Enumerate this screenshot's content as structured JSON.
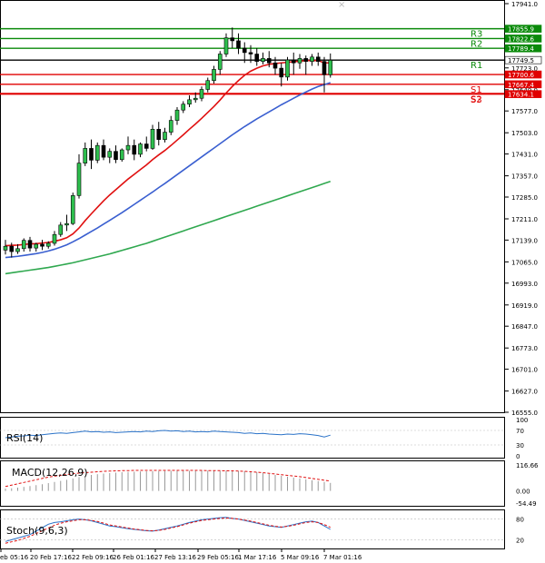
{
  "chart_data": {
    "type": "candlestick",
    "main_panel": {
      "ylim": [
        16555.0,
        17941.0
      ],
      "y_ticks": [
        "17941.0",
        "17859.0",
        "17723.0",
        "17649.0",
        "17577.0",
        "17503.0",
        "17431.0",
        "17357.0",
        "17285.0",
        "17211.0",
        "17139.0",
        "17065.0",
        "16993.0",
        "16919.0",
        "16847.0",
        "16773.0",
        "16701.0",
        "16627.0",
        "16555.0"
      ],
      "candles": [
        {
          "o": 17105,
          "h": 17140,
          "c": 17118,
          "l": 17090
        },
        {
          "o": 17118,
          "h": 17130,
          "c": 17100,
          "l": 17080
        },
        {
          "o": 17100,
          "h": 17125,
          "c": 17110,
          "l": 17092
        },
        {
          "o": 17110,
          "h": 17145,
          "c": 17138,
          "l": 17100
        },
        {
          "o": 17138,
          "h": 17150,
          "c": 17112,
          "l": 17100
        },
        {
          "o": 17112,
          "h": 17130,
          "c": 17125,
          "l": 17100
        },
        {
          "o": 17125,
          "h": 17140,
          "c": 17118,
          "l": 17105
        },
        {
          "o": 17118,
          "h": 17135,
          "c": 17128,
          "l": 17110
        },
        {
          "o": 17128,
          "h": 17170,
          "c": 17158,
          "l": 17120
        },
        {
          "o": 17158,
          "h": 17200,
          "c": 17190,
          "l": 17150
        },
        {
          "o": 17190,
          "h": 17225,
          "c": 17195,
          "l": 17170
        },
        {
          "o": 17195,
          "h": 17300,
          "c": 17290,
          "l": 17190
        },
        {
          "o": 17290,
          "h": 17430,
          "c": 17400,
          "l": 17280
        },
        {
          "o": 17400,
          "h": 17470,
          "c": 17450,
          "l": 17390
        },
        {
          "o": 17450,
          "h": 17480,
          "c": 17410,
          "l": 17380
        },
        {
          "o": 17410,
          "h": 17470,
          "c": 17460,
          "l": 17400
        },
        {
          "o": 17460,
          "h": 17480,
          "c": 17420,
          "l": 17410
        },
        {
          "o": 17420,
          "h": 17450,
          "c": 17440,
          "l": 17400
        },
        {
          "o": 17440,
          "h": 17460,
          "c": 17412,
          "l": 17400
        },
        {
          "o": 17412,
          "h": 17450,
          "c": 17445,
          "l": 17405
        },
        {
          "o": 17445,
          "h": 17490,
          "c": 17460,
          "l": 17430
        },
        {
          "o": 17460,
          "h": 17480,
          "c": 17430,
          "l": 17410
        },
        {
          "o": 17430,
          "h": 17470,
          "c": 17465,
          "l": 17420
        },
        {
          "o": 17465,
          "h": 17490,
          "c": 17450,
          "l": 17440
        },
        {
          "o": 17450,
          "h": 17530,
          "c": 17515,
          "l": 17445
        },
        {
          "o": 17515,
          "h": 17540,
          "c": 17480,
          "l": 17460
        },
        {
          "o": 17480,
          "h": 17520,
          "c": 17505,
          "l": 17470
        },
        {
          "o": 17505,
          "h": 17560,
          "c": 17545,
          "l": 17495
        },
        {
          "o": 17545,
          "h": 17590,
          "c": 17580,
          "l": 17530
        },
        {
          "o": 17580,
          "h": 17610,
          "c": 17600,
          "l": 17570
        },
        {
          "o": 17600,
          "h": 17630,
          "c": 17615,
          "l": 17590
        },
        {
          "o": 17615,
          "h": 17640,
          "c": 17620,
          "l": 17605
        },
        {
          "o": 17620,
          "h": 17660,
          "c": 17650,
          "l": 17610
        },
        {
          "o": 17650,
          "h": 17690,
          "c": 17680,
          "l": 17640
        },
        {
          "o": 17680,
          "h": 17730,
          "c": 17718,
          "l": 17670
        },
        {
          "o": 17718,
          "h": 17780,
          "c": 17770,
          "l": 17700
        },
        {
          "o": 17770,
          "h": 17840,
          "c": 17825,
          "l": 17760
        },
        {
          "o": 17825,
          "h": 17860,
          "c": 17815,
          "l": 17790
        },
        {
          "o": 17815,
          "h": 17840,
          "c": 17790,
          "l": 17770
        },
        {
          "o": 17790,
          "h": 17810,
          "c": 17775,
          "l": 17740
        },
        {
          "o": 17775,
          "h": 17800,
          "c": 17770,
          "l": 17740
        },
        {
          "o": 17770,
          "h": 17790,
          "c": 17745,
          "l": 17730
        },
        {
          "o": 17745,
          "h": 17775,
          "c": 17755,
          "l": 17735
        },
        {
          "o": 17755,
          "h": 17780,
          "c": 17740,
          "l": 17725
        },
        {
          "o": 17740,
          "h": 17760,
          "c": 17722,
          "l": 17700
        },
        {
          "o": 17722,
          "h": 17740,
          "c": 17692,
          "l": 17660
        },
        {
          "o": 17692,
          "h": 17760,
          "c": 17750,
          "l": 17680
        },
        {
          "o": 17750,
          "h": 17775,
          "c": 17740,
          "l": 17700
        },
        {
          "o": 17740,
          "h": 17770,
          "c": 17755,
          "l": 17720
        },
        {
          "o": 17755,
          "h": 17765,
          "c": 17745,
          "l": 17700
        },
        {
          "o": 17745,
          "h": 17770,
          "c": 17760,
          "l": 17730
        },
        {
          "o": 17760,
          "h": 17775,
          "c": 17745,
          "l": 17730
        },
        {
          "o": 17745,
          "h": 17760,
          "c": 17700,
          "l": 17640
        },
        {
          "o": 17700,
          "h": 17772,
          "c": 17749,
          "l": 17690
        }
      ],
      "ma_fast": [
        17120,
        17121,
        17122,
        17124,
        17126,
        17127,
        17129,
        17131,
        17135,
        17140,
        17147,
        17160,
        17180,
        17205,
        17228,
        17250,
        17272,
        17292,
        17310,
        17328,
        17346,
        17362,
        17378,
        17394,
        17412,
        17428,
        17443,
        17460,
        17478,
        17496,
        17515,
        17533,
        17552,
        17572,
        17592,
        17614,
        17638,
        17660,
        17680,
        17698,
        17712,
        17722,
        17730,
        17735,
        17738,
        17740,
        17742,
        17744,
        17746,
        17748,
        17748,
        17748,
        17740,
        17740
      ],
      "ma_mid": [
        17080,
        17082,
        17084,
        17087,
        17090,
        17093,
        17097,
        17102,
        17108,
        17115,
        17123,
        17133,
        17144,
        17156,
        17168,
        17180,
        17193,
        17206,
        17219,
        17232,
        17246,
        17260,
        17274,
        17288,
        17302,
        17317,
        17331,
        17346,
        17361,
        17376,
        17391,
        17406,
        17421,
        17436,
        17451,
        17466,
        17481,
        17496,
        17510,
        17524,
        17537,
        17550,
        17562,
        17574,
        17586,
        17598,
        17609,
        17620,
        17631,
        17641,
        17651,
        17660,
        17666,
        17673
      ],
      "ma_slow": [
        17025,
        17028,
        17031,
        17034,
        17037,
        17040,
        17043,
        17046,
        17050,
        17054,
        17058,
        17062,
        17067,
        17072,
        17077,
        17082,
        17087,
        17092,
        17098,
        17104,
        17110,
        17116,
        17122,
        17128,
        17135,
        17142,
        17149,
        17156,
        17163,
        17170,
        17177,
        17184,
        17191,
        17198,
        17205,
        17212,
        17219,
        17226,
        17233,
        17240,
        17247,
        17254,
        17261,
        17268,
        17275,
        17282,
        17289,
        17296,
        17303,
        17310,
        17317,
        17324,
        17331,
        17338
      ],
      "levels": [
        {
          "label": "R3",
          "value": 17855.9,
          "tag": "17855.9",
          "color": "#0a8a0a"
        },
        {
          "label": "R2",
          "value": 17822.6,
          "tag": "17822.6",
          "color": "#0a8a0a"
        },
        {
          "label": "",
          "value": 17789.4,
          "tag": "17789.4",
          "color": "#0a8a0a"
        },
        {
          "label": "R1",
          "value": 17749.5,
          "tag": "17749.5",
          "color": "#000000"
        },
        {
          "label": "",
          "value": 17700.6,
          "tag": "17700.6",
          "color": "#e00000"
        },
        {
          "label": "S1",
          "value": 17667.4,
          "tag": "17667.4",
          "color": "#e00000"
        },
        {
          "label": "S2",
          "value": 17634.1,
          "tag": "17634.1",
          "color": "#e00000"
        },
        {
          "label": "S3",
          "value": 17634.1,
          "tag": "",
          "color": "#e00000"
        }
      ],
      "price_tag": "17749.5"
    },
    "rsi_panel": {
      "label": "RSI(14)",
      "y_ticks": [
        "100",
        "70",
        "30",
        "0"
      ],
      "ylim": [
        0,
        100
      ],
      "values": [
        50,
        52,
        54,
        55,
        57,
        56,
        58,
        60,
        62,
        63,
        62,
        64,
        66,
        68,
        66,
        67,
        65,
        66,
        64,
        65,
        66,
        67,
        66,
        68,
        67,
        69,
        70,
        68,
        69,
        67,
        68,
        66,
        67,
        66,
        68,
        67,
        66,
        65,
        64,
        62,
        63,
        61,
        62,
        60,
        59,
        58,
        60,
        59,
        61,
        60,
        58,
        56,
        52,
        57
      ]
    },
    "macd_panel": {
      "label": "MACD(12,26,9)",
      "y_ticks": [
        "116.66",
        "0.00",
        "-54.49"
      ],
      "ylim": [
        -54.49,
        116.66
      ],
      "histogram": [
        10,
        12,
        15,
        18,
        22,
        26,
        30,
        35,
        40,
        45,
        50,
        56,
        62,
        68,
        72,
        75,
        78,
        80,
        82,
        84,
        85,
        86,
        87,
        88,
        88,
        89,
        89,
        90,
        90,
        90,
        90,
        90,
        91,
        91,
        91,
        91,
        90,
        90,
        89,
        88,
        86,
        84,
        80,
        76,
        72,
        68,
        64,
        60,
        56,
        52,
        48,
        44,
        40,
        36
      ],
      "signal": [
        20,
        26,
        32,
        38,
        44,
        50,
        56,
        62,
        66,
        70,
        74,
        77,
        80,
        82,
        84,
        86,
        88,
        89,
        90,
        91,
        91,
        92,
        92,
        92,
        92,
        92,
        92,
        92,
        92,
        92,
        92,
        92,
        92,
        91,
        91,
        91,
        90,
        90,
        89,
        88,
        86,
        84,
        82,
        79,
        76,
        73,
        70,
        67,
        64,
        60,
        56,
        52,
        48,
        44
      ]
    },
    "stoch_panel": {
      "label": "Stoch(9,6,3)",
      "y_ticks": [
        "80",
        "20"
      ],
      "ylim": [
        0,
        100
      ],
      "k": [
        15,
        20,
        25,
        30,
        35,
        45,
        55,
        65,
        70,
        72,
        75,
        78,
        80,
        78,
        75,
        70,
        65,
        60,
        58,
        55,
        52,
        50,
        48,
        46,
        45,
        48,
        52,
        56,
        60,
        65,
        70,
        74,
        78,
        80,
        82,
        84,
        85,
        82,
        80,
        76,
        72,
        68,
        64,
        60,
        58,
        56,
        60,
        64,
        68,
        72,
        74,
        70,
        60,
        50
      ],
      "d": [
        10,
        14,
        18,
        24,
        30,
        38,
        46,
        54,
        62,
        68,
        72,
        75,
        78,
        78,
        76,
        73,
        68,
        63,
        60,
        57,
        54,
        51,
        49,
        47,
        46,
        47,
        50,
        54,
        58,
        63,
        68,
        72,
        76,
        78,
        80,
        82,
        83,
        82,
        80,
        77,
        74,
        70,
        66,
        62,
        59,
        57,
        59,
        62,
        66,
        70,
        72,
        70,
        64,
        56
      ]
    },
    "x_ticks": [
      "eb 05:16",
      "20 Feb 17:16",
      "22 Feb 09:16",
      "26 Feb 01:16",
      "27 Feb 13:16",
      "29 Feb 05:16",
      "1 Mar 17:16",
      "5 Mar 09:16",
      "7 Mar 01:16"
    ]
  }
}
